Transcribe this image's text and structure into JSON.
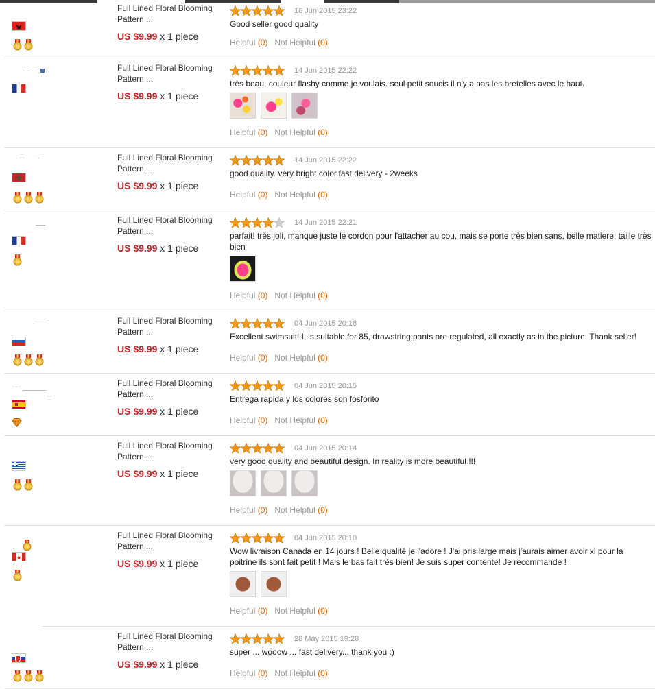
{
  "labels": {
    "currency": "US $9.99",
    "quantity": "x 1 piece",
    "helpful": "Helpful",
    "not_helpful": "Not Helpful"
  },
  "colors": {
    "price": "#c4272b",
    "vote_count": "#e0690b",
    "star": "#f39a1a",
    "star_empty": "#d0d0d0",
    "divider": "#dcdcdc"
  },
  "reviews": [
    {
      "product_line1": "Full Lined Floral Blooming",
      "product_line2": "Pattern ...",
      "price": "US $9.99",
      "qty": "x 1 piece",
      "rating": 5,
      "date": "16 Jun 2015 23:22",
      "text": "Good seller good quality",
      "flag": "albania",
      "medals": 2,
      "badge": "gold-medal",
      "photos": 0,
      "helpful_count": "(0)",
      "not_helpful_count": "(0)"
    },
    {
      "product_line1": "Full Lined Floral Blooming",
      "product_line2": "Pattern ...",
      "price": "US $9.99",
      "qty": "x 1 piece",
      "rating": 5,
      "date": "14 Jun 2015 22:22",
      "text": "très beau, couleur flashy comme je voulais. seul petit soucis il n'y a pas les bretelles avec le haut.",
      "flag": "france",
      "medals": 0,
      "badge": "none",
      "photos": 3,
      "helpful_count": "(0)",
      "not_helpful_count": "(0)"
    },
    {
      "product_line1": "Full Lined Floral Blooming",
      "product_line2": "Pattern ...",
      "price": "US $9.99",
      "qty": "x 1 piece",
      "rating": 5,
      "date": "14 Jun 2015 22:22",
      "text": "good quality. very bright color.fast delivery - 2weeks",
      "flag": "morocco",
      "medals": 3,
      "badge": "gold-medal",
      "photos": 0,
      "helpful_count": "(0)",
      "not_helpful_count": "(0)"
    },
    {
      "product_line1": "Full Lined Floral Blooming",
      "product_line2": "Pattern ...",
      "price": "US $9.99",
      "qty": "x 1 piece",
      "rating": 4,
      "date": "14 Jun 2015 22:21",
      "text": "parfait! très joli, manque juste le cordon pour l'attacher au cou, mais se porte très bien sans, belle matiere, taille très bien",
      "flag": "france",
      "medals": 1,
      "badge": "gold-medal",
      "photos": 1,
      "helpful_count": "(0)",
      "not_helpful_count": "(0)"
    },
    {
      "product_line1": "Full Lined Floral Blooming",
      "product_line2": "Pattern ...",
      "price": "US $9.99",
      "qty": "x 1 piece",
      "rating": 5,
      "date": "04 Jun 2015 20:16",
      "text": "Excellent swimsuit! L is suitable for 85, drawstring pants are regulated, all exactly as in the picture. Thank seller!",
      "flag": "russia",
      "medals": 3,
      "badge": "gold-medal",
      "photos": 0,
      "helpful_count": "(0)",
      "not_helpful_count": "(0)"
    },
    {
      "product_line1": "Full Lined Floral Blooming",
      "product_line2": "Pattern ...",
      "price": "US $9.99",
      "qty": "x 1 piece",
      "rating": 5,
      "date": "04 Jun 2015 20:15",
      "text": "Entrega rapida y los colores son fosforito",
      "flag": "spain",
      "medals": 1,
      "badge": "diamond",
      "photos": 0,
      "helpful_count": "(0)",
      "not_helpful_count": "(0)"
    },
    {
      "product_line1": "Full Lined Floral Blooming",
      "product_line2": "Pattern ...",
      "price": "US $9.99",
      "qty": "x 1 piece",
      "rating": 5,
      "date": "04 Jun 2015 20:14",
      "text": "very good quality and beautiful design. In reality is more beautiful !!!",
      "flag": "greece",
      "medals": 2,
      "badge": "gold-medal",
      "photos": 3,
      "helpful_count": "(0)",
      "not_helpful_count": "(0)"
    },
    {
      "product_line1": "Full Lined Floral Blooming",
      "product_line2": "Pattern ...",
      "price": "US $9.99",
      "qty": "x 1 piece",
      "rating": 5,
      "date": "04 Jun 2015 20:10",
      "text": "Wow livraison Canada en 14 jours ! Belle qualité je l'adore ! J'ai pris large mais j'aurais aimer avoir xl pour la poitrine ils sont fait petit ! Mais le bas fait très bien! Je suis super contente! Je recommande !",
      "flag": "canada",
      "medals": 1,
      "badge": "gold-medal",
      "photos": 2,
      "helpful_count": "(0)",
      "not_helpful_count": "(0)"
    },
    {
      "product_line1": "Full Lined Floral Blooming",
      "product_line2": "Pattern ...",
      "price": "US $9.99",
      "qty": "x 1 piece",
      "rating": 5,
      "date": "28 May 2015 19:28",
      "text": "super ... wooow ... fast delivery... thank you :)",
      "flag": "slovakia",
      "medals": 3,
      "badge": "gold-medal",
      "photos": 0,
      "helpful_count": "(0)",
      "not_helpful_count": "(0)"
    }
  ]
}
